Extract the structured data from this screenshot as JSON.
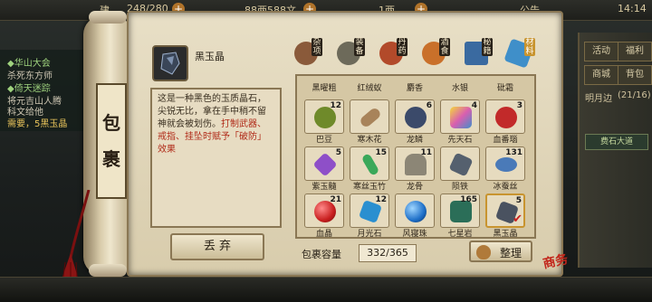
{
  "topbar": {
    "partial_left": "建",
    "stamina": "248/280",
    "coins": "88两588文",
    "yuanbao": "1两",
    "announcement": "公告",
    "time": "14:14"
  },
  "quests": {
    "line1": "◆华山大会",
    "line2": "杀死东方师",
    "line3": "◆倚天迷踪",
    "line4": "将元吉山人腾",
    "line5": "科文给他",
    "line6": "需要，5黑玉晶"
  },
  "right_panel": {
    "activity": "活动",
    "welfare": "福利",
    "shop": "商城",
    "bag": "背包",
    "moon_label": "明月边",
    "moon_count": "(21/16)",
    "road": "费石大道"
  },
  "scroll_title": "包裹",
  "selected_item": {
    "name": "黑玉晶",
    "icon": "black-jade-crystal-icon",
    "description_normal": "这是一种黑色的玉质晶石，尖锐无比，拿在手中稍不留神就会被划伤。",
    "description_red": "打制武器、戒指、挂坠时赋予「破防」效果"
  },
  "discard_label": "丢 弃",
  "tabs": [
    {
      "label": "杂项",
      "icon": "misc-bag-icon",
      "color": "#8a5a3a"
    },
    {
      "label": "装备",
      "icon": "armor-icon",
      "color": "#6d6a5a"
    },
    {
      "label": "丹药",
      "icon": "pill-gourd-icon",
      "color": "#b24a2a"
    },
    {
      "label": "酒食",
      "icon": "food-bowl-icon",
      "color": "#c9702a"
    },
    {
      "label": "秘籍",
      "icon": "book-icon",
      "color": "#3a6aa0"
    },
    {
      "label": "材料",
      "icon": "crystal-icon",
      "color": "#3f8fc9"
    }
  ],
  "active_tab": "材料",
  "grid_partial_row": [
    "黑曜粗",
    "红绒蚁",
    "麝香",
    "水银",
    "砒霜"
  ],
  "grid_items": [
    {
      "name": "巴豆",
      "count": "12",
      "icon": "croton-icon",
      "color": "#6f8a2a"
    },
    {
      "name": "寒木花",
      "count": "",
      "icon": "wood-log-icon",
      "color": "#a8835a"
    },
    {
      "name": "龙鳞",
      "count": "6",
      "icon": "dragon-scale-icon",
      "color": "#3b4a6a"
    },
    {
      "name": "先天石",
      "count": "4",
      "icon": "rainbow-stone-icon",
      "color": "#d95fb0"
    },
    {
      "name": "血番瑙",
      "count": "3",
      "icon": "blood-agate-icon",
      "color": "#c22a2a"
    },
    {
      "name": "紫玉髓",
      "count": "5",
      "icon": "purple-crystal-icon",
      "color": "#8e4fc8"
    },
    {
      "name": "寒丝玉竹",
      "count": "15",
      "icon": "jade-bamboo-icon",
      "color": "#3aa85a"
    },
    {
      "name": "龙骨",
      "count": "11",
      "icon": "dragon-bone-icon",
      "color": "#8c8676"
    },
    {
      "name": "陨铁",
      "count": "",
      "icon": "meteor-iron-icon",
      "color": "#55606e"
    },
    {
      "name": "冰蚕丝",
      "count": "131",
      "icon": "ice-silk-icon",
      "color": "#4a7ab8"
    },
    {
      "name": "血晶",
      "count": "21",
      "icon": "blood-crystal-icon",
      "color": "#c81e1e"
    },
    {
      "name": "月光石",
      "count": "12",
      "icon": "moonstone-icon",
      "color": "#2a8fd0"
    },
    {
      "name": "风寝珠",
      "count": "",
      "icon": "wind-pearl-icon",
      "color": "#1e6fc8"
    },
    {
      "name": "七星岩",
      "count": "165",
      "icon": "seven-star-rock-icon",
      "color": "#2b6e58"
    },
    {
      "name": "黑玉晶",
      "count": "5",
      "icon": "black-jade-crystal-icon",
      "color": "#4a5260"
    }
  ],
  "capacity_label": "包裹容量",
  "capacity_value": "332/365",
  "sort_label": "整理",
  "seal_text": "商务"
}
